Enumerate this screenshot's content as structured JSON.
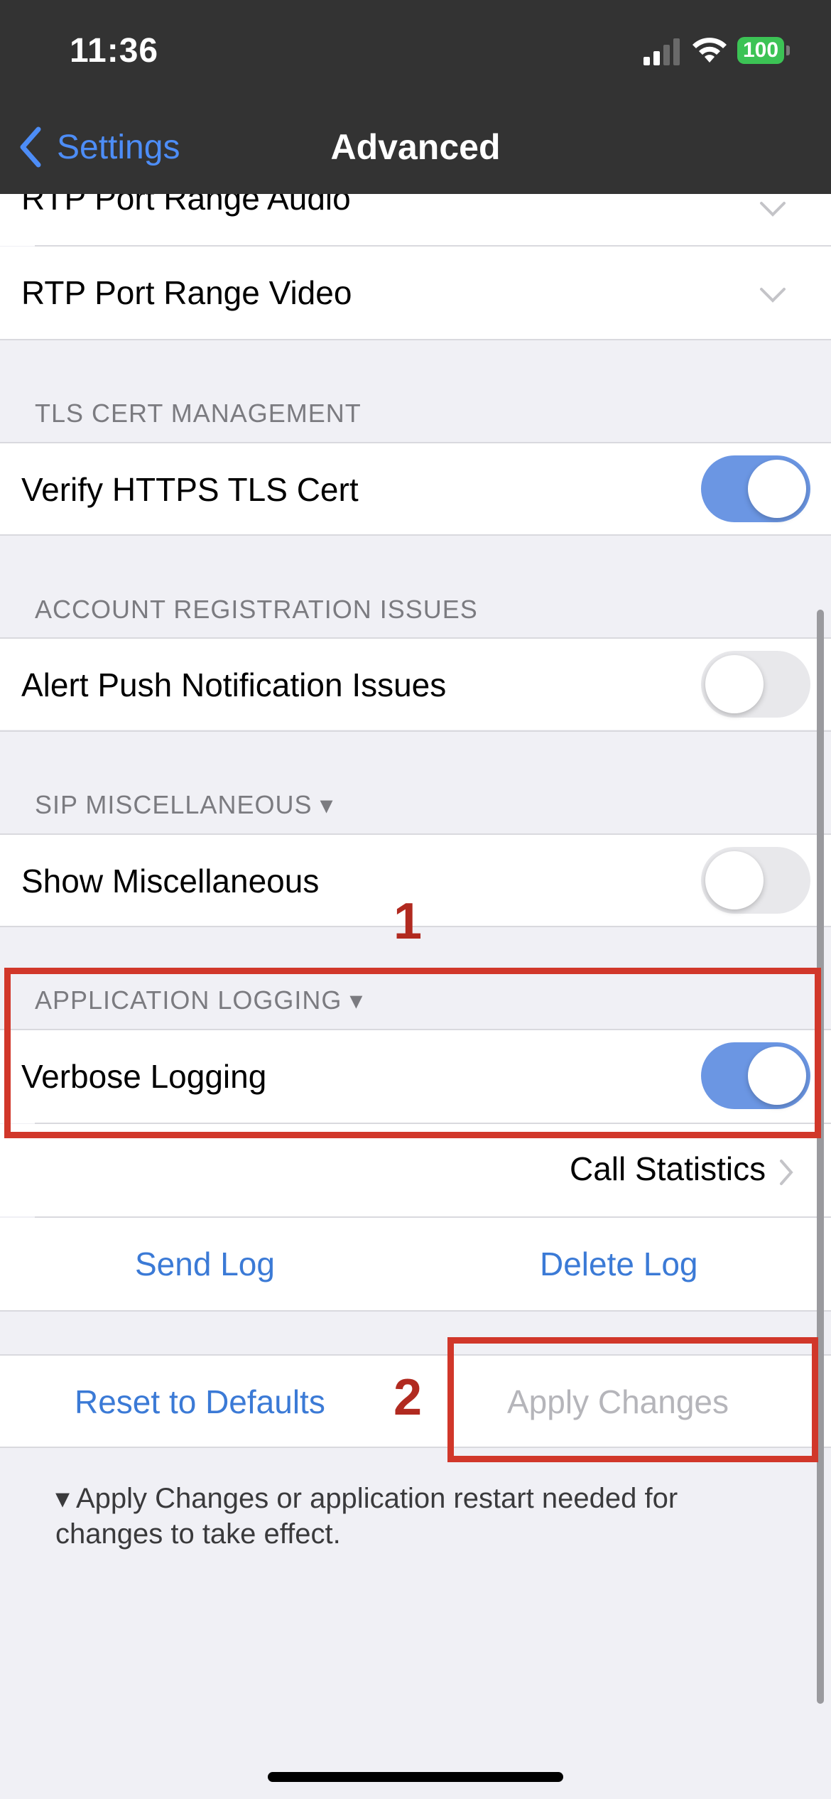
{
  "status_bar": {
    "time": "11:36",
    "battery": "100"
  },
  "nav": {
    "back_label": "Settings",
    "title": "Advanced"
  },
  "rows": {
    "rtp_audio": "RTP Port Range Audio",
    "rtp_video": "RTP Port Range Video"
  },
  "sections": {
    "tls": {
      "header": "TLS CERT MANAGEMENT",
      "verify_label": "Verify HTTPS TLS Cert",
      "verify_on": true
    },
    "account": {
      "header": "ACCOUNT REGISTRATION ISSUES",
      "alert_label": "Alert Push Notification Issues",
      "alert_on": false
    },
    "sip": {
      "header": "SIP MISCELLANEOUS ▾",
      "show_label": "Show Miscellaneous",
      "show_on": false
    },
    "logging": {
      "header": "APPLICATION LOGGING ▾",
      "verbose_label": "Verbose Logging",
      "verbose_on": true,
      "call_stats_label": "Call Statistics",
      "send_log": "Send Log",
      "delete_log": "Delete Log"
    }
  },
  "actions": {
    "reset": "Reset to Defaults",
    "apply": "Apply Changes"
  },
  "footnote": "▾ Apply Changes or application restart needed for changes to take effect.",
  "annotations": {
    "one": "1",
    "two": "2"
  },
  "colors": {
    "accent": "#3b7ad6",
    "toggle_on": "#6b96e3",
    "annotation_red": "#d1372a",
    "disabled_text": "#b5b5ba"
  }
}
